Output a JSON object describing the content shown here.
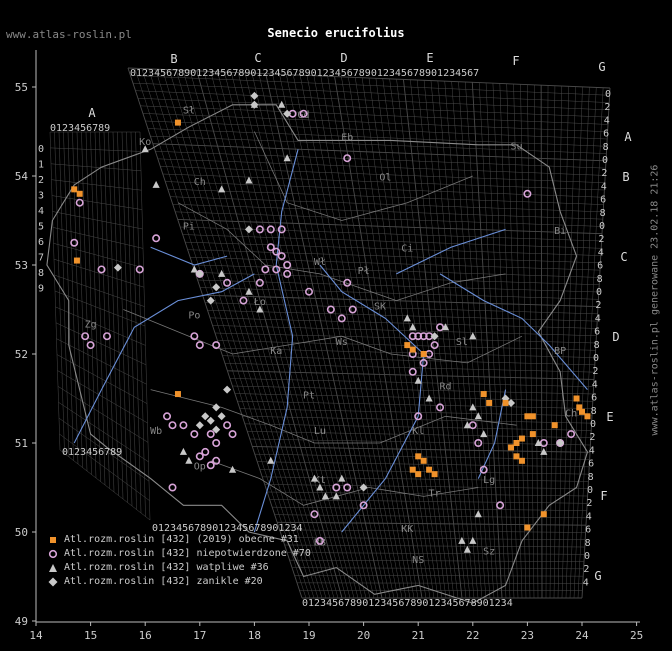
{
  "header": {
    "site": "www.atlas-roslin.pl",
    "title": "Senecio erucifolius",
    "side_text": "www.atlas-roslin.pl generowane 23.02.18 21:26"
  },
  "axes": {
    "x_ticks": [
      "14",
      "15",
      "16",
      "17",
      "18",
      "19",
      "20",
      "21",
      "22",
      "23",
      "24",
      "25"
    ],
    "y_ticks": [
      "55",
      "54",
      "53",
      "52",
      "51",
      "50",
      "49"
    ]
  },
  "grid": {
    "col_letters": [
      "A",
      "B",
      "C",
      "D",
      "E",
      "F",
      "G"
    ],
    "row_letters": [
      "A",
      "B",
      "C",
      "D",
      "E",
      "F",
      "G"
    ],
    "digits": "0123456789",
    "region_labels": [
      "Sł",
      "Gd",
      "Eb",
      "Su",
      "Ol",
      "Ch",
      "Ko",
      "Pi",
      "Bi",
      "Ci",
      "Wł",
      "Pł",
      "Ws",
      "Ło",
      "SK",
      "Sl",
      "BP",
      "Zg",
      "Po",
      "Ka",
      "Wb",
      "Pt",
      "Rd",
      "Ch",
      "Lu",
      "Op",
      "Kt",
      "Kl",
      "Tr",
      "KK",
      "NS",
      "BB",
      "Lg",
      "Sz"
    ],
    "colors": {
      "bg": "#000000",
      "grid": "#4a4a4a",
      "border": "#8a8a8a",
      "rivers": "#6a8fd8"
    }
  },
  "legend": [
    {
      "symbol": "square",
      "color": "#f0922b",
      "label": "Atl.rozm.roslin [432] (2019) obecne #31"
    },
    {
      "symbol": "circle",
      "color": "#d8a4d8",
      "label": "Atl.rozm.roslin [432] niepotwierdzone #70"
    },
    {
      "symbol": "triangle",
      "color": "#c8c8c8",
      "label": "Atl.rozm.roslin [432] watpliwe #36"
    },
    {
      "symbol": "diamond",
      "color": "#c8c8c8",
      "label": "Atl.rozm.roslin [432] zanikle #20"
    }
  ],
  "records": {
    "present": [
      [
        14.7,
        53.85
      ],
      [
        14.8,
        53.8
      ],
      [
        14.75,
        53.05
      ],
      [
        16.6,
        54.6
      ],
      [
        16.6,
        51.55
      ],
      [
        20.8,
        52.1
      ],
      [
        20.9,
        52.05
      ],
      [
        21.1,
        52.0
      ],
      [
        22.2,
        51.55
      ],
      [
        22.3,
        51.45
      ],
      [
        22.6,
        51.45
      ],
      [
        23.0,
        51.3
      ],
      [
        23.1,
        51.3
      ],
      [
        23.9,
        51.5
      ],
      [
        23.95,
        51.4
      ],
      [
        24.0,
        51.35
      ],
      [
        24.1,
        51.3
      ],
      [
        23.5,
        51.2
      ],
      [
        23.1,
        51.1
      ],
      [
        22.9,
        51.05
      ],
      [
        22.8,
        51.0
      ],
      [
        22.7,
        50.95
      ],
      [
        22.8,
        50.85
      ],
      [
        22.9,
        50.8
      ],
      [
        21.0,
        50.85
      ],
      [
        21.1,
        50.8
      ],
      [
        20.9,
        50.7
      ],
      [
        21.0,
        50.65
      ],
      [
        21.2,
        50.7
      ],
      [
        21.3,
        50.65
      ],
      [
        23.3,
        50.2
      ],
      [
        23.0,
        50.05
      ]
    ],
    "unconfirmed": [
      [
        14.8,
        53.7
      ],
      [
        14.7,
        53.25
      ],
      [
        15.2,
        52.95
      ],
      [
        15.9,
        52.95
      ],
      [
        16.2,
        53.3
      ],
      [
        14.9,
        52.2
      ],
      [
        15.0,
        52.1
      ],
      [
        15.3,
        52.2
      ],
      [
        16.4,
        51.3
      ],
      [
        16.5,
        51.2
      ],
      [
        16.7,
        51.2
      ],
      [
        16.9,
        51.1
      ],
      [
        17.2,
        51.1
      ],
      [
        17.5,
        51.2
      ],
      [
        17.6,
        51.1
      ],
      [
        17.3,
        51.0
      ],
      [
        17.1,
        50.9
      ],
      [
        17.0,
        50.85
      ],
      [
        17.3,
        50.8
      ],
      [
        17.2,
        50.75
      ],
      [
        16.9,
        52.2
      ],
      [
        17.0,
        52.1
      ],
      [
        17.3,
        52.1
      ],
      [
        17.0,
        52.9
      ],
      [
        17.5,
        52.8
      ],
      [
        17.8,
        52.6
      ],
      [
        18.1,
        53.4
      ],
      [
        18.3,
        53.4
      ],
      [
        18.5,
        53.4
      ],
      [
        18.3,
        53.2
      ],
      [
        18.4,
        53.15
      ],
      [
        18.5,
        53.1
      ],
      [
        18.6,
        53.0
      ],
      [
        18.4,
        52.95
      ],
      [
        18.6,
        52.9
      ],
      [
        18.2,
        52.95
      ],
      [
        18.1,
        52.8
      ],
      [
        19.0,
        52.7
      ],
      [
        19.4,
        52.5
      ],
      [
        19.6,
        52.4
      ],
      [
        19.8,
        52.5
      ],
      [
        19.7,
        52.8
      ],
      [
        19.7,
        54.2
      ],
      [
        18.7,
        54.7
      ],
      [
        18.9,
        54.7
      ],
      [
        20.9,
        52.2
      ],
      [
        21.0,
        52.2
      ],
      [
        21.1,
        52.2
      ],
      [
        21.2,
        52.2
      ],
      [
        21.3,
        52.1
      ],
      [
        21.2,
        52.0
      ],
      [
        21.4,
        52.3
      ],
      [
        21.1,
        51.9
      ],
      [
        21.0,
        51.3
      ],
      [
        20.9,
        51.8
      ],
      [
        21.4,
        51.4
      ],
      [
        22.0,
        51.2
      ],
      [
        22.1,
        51.0
      ],
      [
        22.2,
        50.7
      ],
      [
        22.5,
        50.3
      ],
      [
        23.0,
        53.8
      ],
      [
        23.6,
        51.0
      ],
      [
        23.8,
        51.1
      ],
      [
        23.3,
        51.0
      ],
      [
        19.1,
        50.2
      ],
      [
        19.2,
        49.9
      ],
      [
        20.0,
        50.3
      ],
      [
        19.7,
        50.5
      ],
      [
        19.5,
        50.5
      ],
      [
        16.5,
        50.5
      ],
      [
        20.9,
        52.0
      ]
    ],
    "doubtful": [
      [
        16.0,
        54.3
      ],
      [
        16.2,
        53.9
      ],
      [
        17.4,
        53.85
      ],
      [
        17.9,
        53.95
      ],
      [
        18.0,
        54.8
      ],
      [
        18.5,
        54.8
      ],
      [
        18.6,
        54.2
      ],
      [
        16.9,
        52.95
      ],
      [
        17.4,
        52.9
      ],
      [
        17.9,
        52.7
      ],
      [
        18.1,
        52.5
      ],
      [
        20.8,
        52.4
      ],
      [
        20.9,
        52.3
      ],
      [
        21.5,
        52.3
      ],
      [
        22.0,
        52.2
      ],
      [
        21.0,
        51.7
      ],
      [
        21.2,
        51.5
      ],
      [
        22.0,
        51.4
      ],
      [
        22.1,
        51.3
      ],
      [
        22.2,
        51.1
      ],
      [
        21.9,
        51.2
      ],
      [
        23.3,
        50.9
      ],
      [
        23.2,
        51.0
      ],
      [
        19.1,
        50.6
      ],
      [
        19.2,
        50.5
      ],
      [
        19.3,
        50.4
      ],
      [
        19.5,
        50.4
      ],
      [
        19.6,
        50.6
      ],
      [
        18.3,
        50.8
      ],
      [
        17.6,
        50.7
      ],
      [
        16.7,
        50.9
      ],
      [
        16.8,
        50.8
      ],
      [
        21.8,
        49.9
      ],
      [
        21.9,
        49.8
      ],
      [
        22.0,
        49.9
      ],
      [
        22.1,
        50.2
      ]
    ],
    "extinct": [
      [
        15.5,
        52.97
      ],
      [
        17.0,
        52.9
      ],
      [
        17.3,
        52.75
      ],
      [
        17.2,
        52.6
      ],
      [
        17.3,
        51.4
      ],
      [
        17.1,
        51.3
      ],
      [
        17.2,
        51.25
      ],
      [
        17.4,
        51.3
      ],
      [
        17.0,
        51.2
      ],
      [
        17.3,
        51.15
      ],
      [
        17.5,
        51.6
      ],
      [
        18.0,
        54.9
      ],
      [
        18.0,
        54.8
      ],
      [
        18.6,
        54.7
      ],
      [
        17.9,
        53.4
      ],
      [
        21.3,
        52.2
      ],
      [
        22.6,
        51.5
      ],
      [
        22.7,
        51.45
      ],
      [
        23.6,
        51.0
      ],
      [
        20.0,
        50.5
      ]
    ]
  }
}
